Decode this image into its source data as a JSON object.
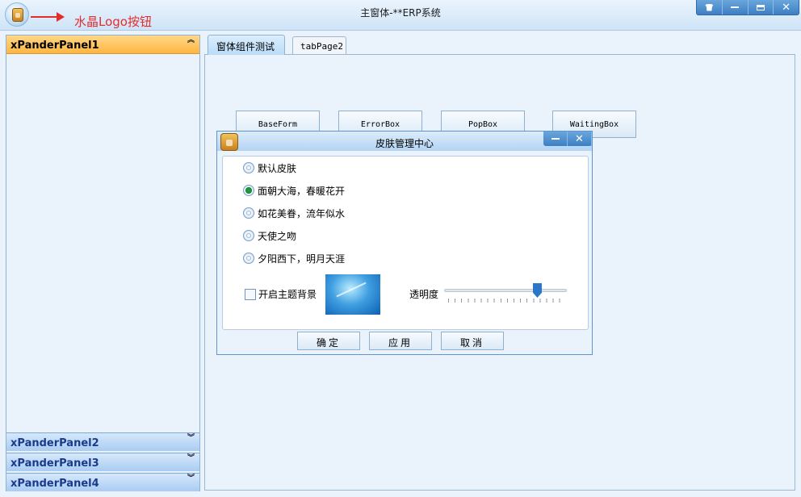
{
  "window": {
    "title": "主窗体-**ERP系统",
    "annotation": "水晶Logo按钮"
  },
  "left_panels": [
    {
      "label": "xPanderPanel1",
      "expanded": true
    },
    {
      "label": "xPanderPanel2",
      "expanded": false
    },
    {
      "label": "xPanderPanel3",
      "expanded": false
    },
    {
      "label": "xPanderPanel4",
      "expanded": false
    }
  ],
  "tabs": [
    {
      "label": "窗体组件测试",
      "active": true
    },
    {
      "label": "tabPage2",
      "active": false
    }
  ],
  "buttons": [
    "BaseForm",
    "ErrorBox",
    "PopBox",
    "WaitingBox"
  ],
  "dialog": {
    "title": "皮肤管理中心",
    "skins": [
      {
        "label": "默认皮肤",
        "selected": false
      },
      {
        "label": "面朝大海，春暖花开",
        "selected": true
      },
      {
        "label": "如花美眷，流年似水",
        "selected": false
      },
      {
        "label": "天使之吻",
        "selected": false
      },
      {
        "label": "夕阳西下，明月天涯",
        "selected": false
      }
    ],
    "theme_bg_label": "开启主题背景",
    "theme_bg_checked": false,
    "opacity_label": "透明度",
    "opacity_level": 0.78,
    "ok": "确定",
    "apply": "应用",
    "cancel": "取消"
  },
  "colors": {
    "accent_blue": "#3c7fc4",
    "active_panel": "#ffb541",
    "annotation_red": "#e52c2c",
    "radio_selected": "#1f9a3b"
  }
}
